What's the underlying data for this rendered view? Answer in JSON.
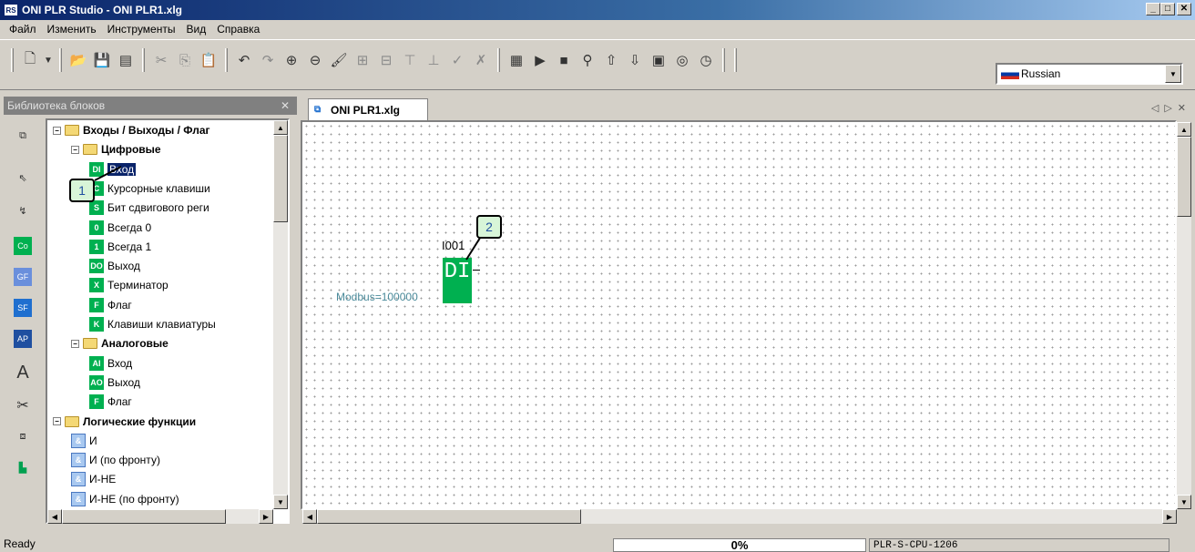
{
  "window": {
    "title": "ONI PLR Studio - ONI PLR1.xlg",
    "app_badge": "RS"
  },
  "menu": [
    "Файл",
    "Изменить",
    "Инструменты",
    "Вид",
    "Справка"
  ],
  "language": {
    "selected": "Russian"
  },
  "library": {
    "title": "Библиотека блоков",
    "tree": [
      {
        "label": "Входы / Выходы / Флаг",
        "bold": true,
        "level": 0,
        "type": "folder"
      },
      {
        "label": "Цифровые",
        "bold": true,
        "level": 1,
        "type": "folder"
      },
      {
        "label": "Вход",
        "level": 2,
        "icon": "DI",
        "selected": true
      },
      {
        "label": "Курсорные клавиши",
        "level": 2,
        "icon": "C"
      },
      {
        "label": "Бит сдвигового реги",
        "level": 2,
        "icon": "S"
      },
      {
        "label": "Всегда 0",
        "level": 2,
        "icon": "0"
      },
      {
        "label": "Всегда 1",
        "level": 2,
        "icon": "1"
      },
      {
        "label": "Выход",
        "level": 2,
        "icon": "DO"
      },
      {
        "label": "Терминатор",
        "level": 2,
        "icon": "X"
      },
      {
        "label": "Флаг",
        "level": 2,
        "icon": "F"
      },
      {
        "label": "Клавиши клавиатуры",
        "level": 2,
        "icon": "K"
      },
      {
        "label": "Аналоговые",
        "bold": true,
        "level": 1,
        "type": "folder"
      },
      {
        "label": "Вход",
        "level": 2,
        "icon": "AI"
      },
      {
        "label": "Выход",
        "level": 2,
        "icon": "AO"
      },
      {
        "label": "Флаг",
        "level": 2,
        "icon": "F"
      },
      {
        "label": "Логические функции",
        "bold": true,
        "level": 0,
        "type": "folder"
      },
      {
        "label": "И",
        "level": 1,
        "icon": "&",
        "logic": true
      },
      {
        "label": "И (по фронту)",
        "level": 1,
        "icon": "&",
        "logic": true
      },
      {
        "label": "И-НЕ",
        "level": 1,
        "icon": "&",
        "logic": true
      },
      {
        "label": "И-НЕ (по фронту)",
        "level": 1,
        "icon": "&",
        "logic": true
      }
    ],
    "side_tools": [
      "Co",
      "GF",
      "SF",
      "AP"
    ]
  },
  "document": {
    "tab_label": "ONI PLR1.xlg"
  },
  "canvas": {
    "block": {
      "id": "I001",
      "type": "DI",
      "address": "Modbus=100000"
    },
    "callout_1": "1",
    "callout_2": "2"
  },
  "status": {
    "text": "Ready",
    "progress": "0%",
    "cpu": "PLR-S-CPU-1206"
  }
}
